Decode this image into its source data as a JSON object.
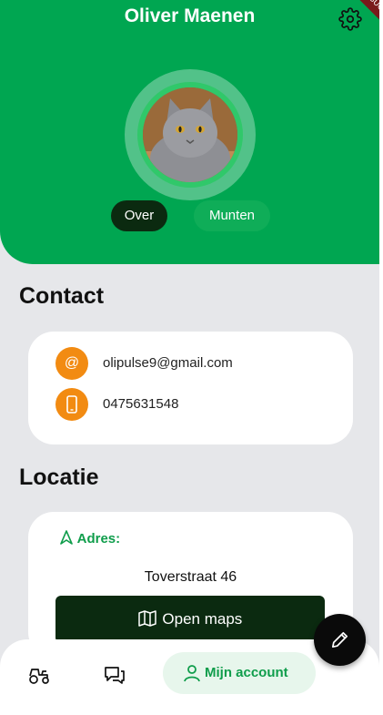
{
  "profile": {
    "name": "Oliver Maenen",
    "debug_banner": "DEBUG"
  },
  "tabs": [
    {
      "label": "Over",
      "active": true
    },
    {
      "label": "Munten",
      "active": false
    }
  ],
  "contact": {
    "title": "Contact",
    "email_icon": "@",
    "email": "olipulse9@gmail.com",
    "phone": "0475631548"
  },
  "locatie": {
    "title": "Locatie",
    "adres_label": "Adres:",
    "adres": "Toverstraat 46",
    "maps_button": "Open maps"
  },
  "nav": {
    "items": [
      "tractor-icon",
      "chat-icon",
      "user-icon"
    ],
    "active_label": "Mijn account"
  },
  "colors": {
    "brand_green": "#00a651",
    "dark_green": "#0b2a10",
    "accent_orange": "#f28b12"
  }
}
